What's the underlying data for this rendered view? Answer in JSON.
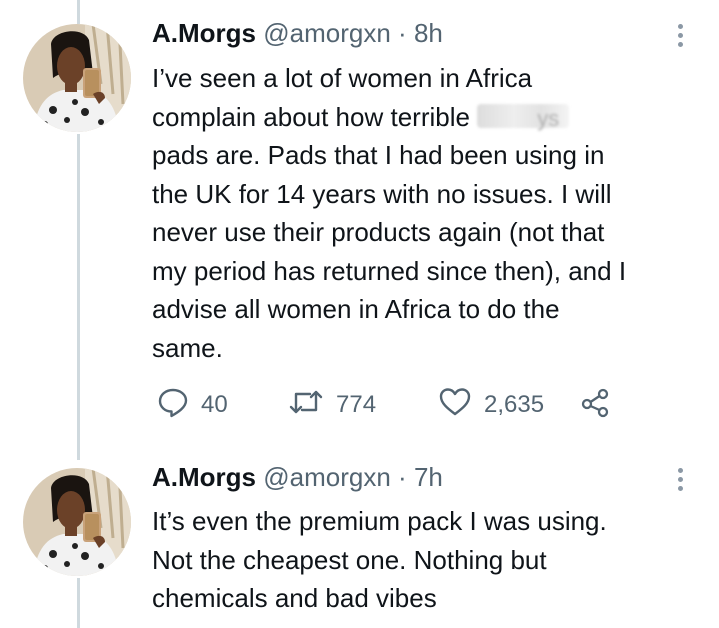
{
  "tweets": [
    {
      "display_name": "A.Morgs",
      "handle": "@amorgxn",
      "separator": "·",
      "time": "8h",
      "lines": [
        "I’ve seen a lot of women in Africa",
        "complain about how terrible",
        "pads are. Pads that I had been using in",
        "the UK for 14 years with no issues. I will",
        "never use their products again (not that",
        "my period has returned since then), and I",
        "advise all women in Africa to do the",
        "same."
      ],
      "redacted_fragment": "ys",
      "replies": "40",
      "retweets": "774",
      "likes": "2,635"
    },
    {
      "display_name": "A.Morgs",
      "handle": "@amorgxn",
      "separator": "·",
      "time": "7h",
      "lines": [
        "It’s even the premium pack I was using.",
        "Not the cheapest one. Nothing but",
        "chemicals and bad vibes"
      ]
    }
  ],
  "icons": [
    "reply-icon",
    "retweet-icon",
    "like-icon",
    "share-icon",
    "more-options-icon"
  ],
  "colors": {
    "text": "#0f1419",
    "secondary": "#536471",
    "thread_line": "#cfd9de"
  }
}
